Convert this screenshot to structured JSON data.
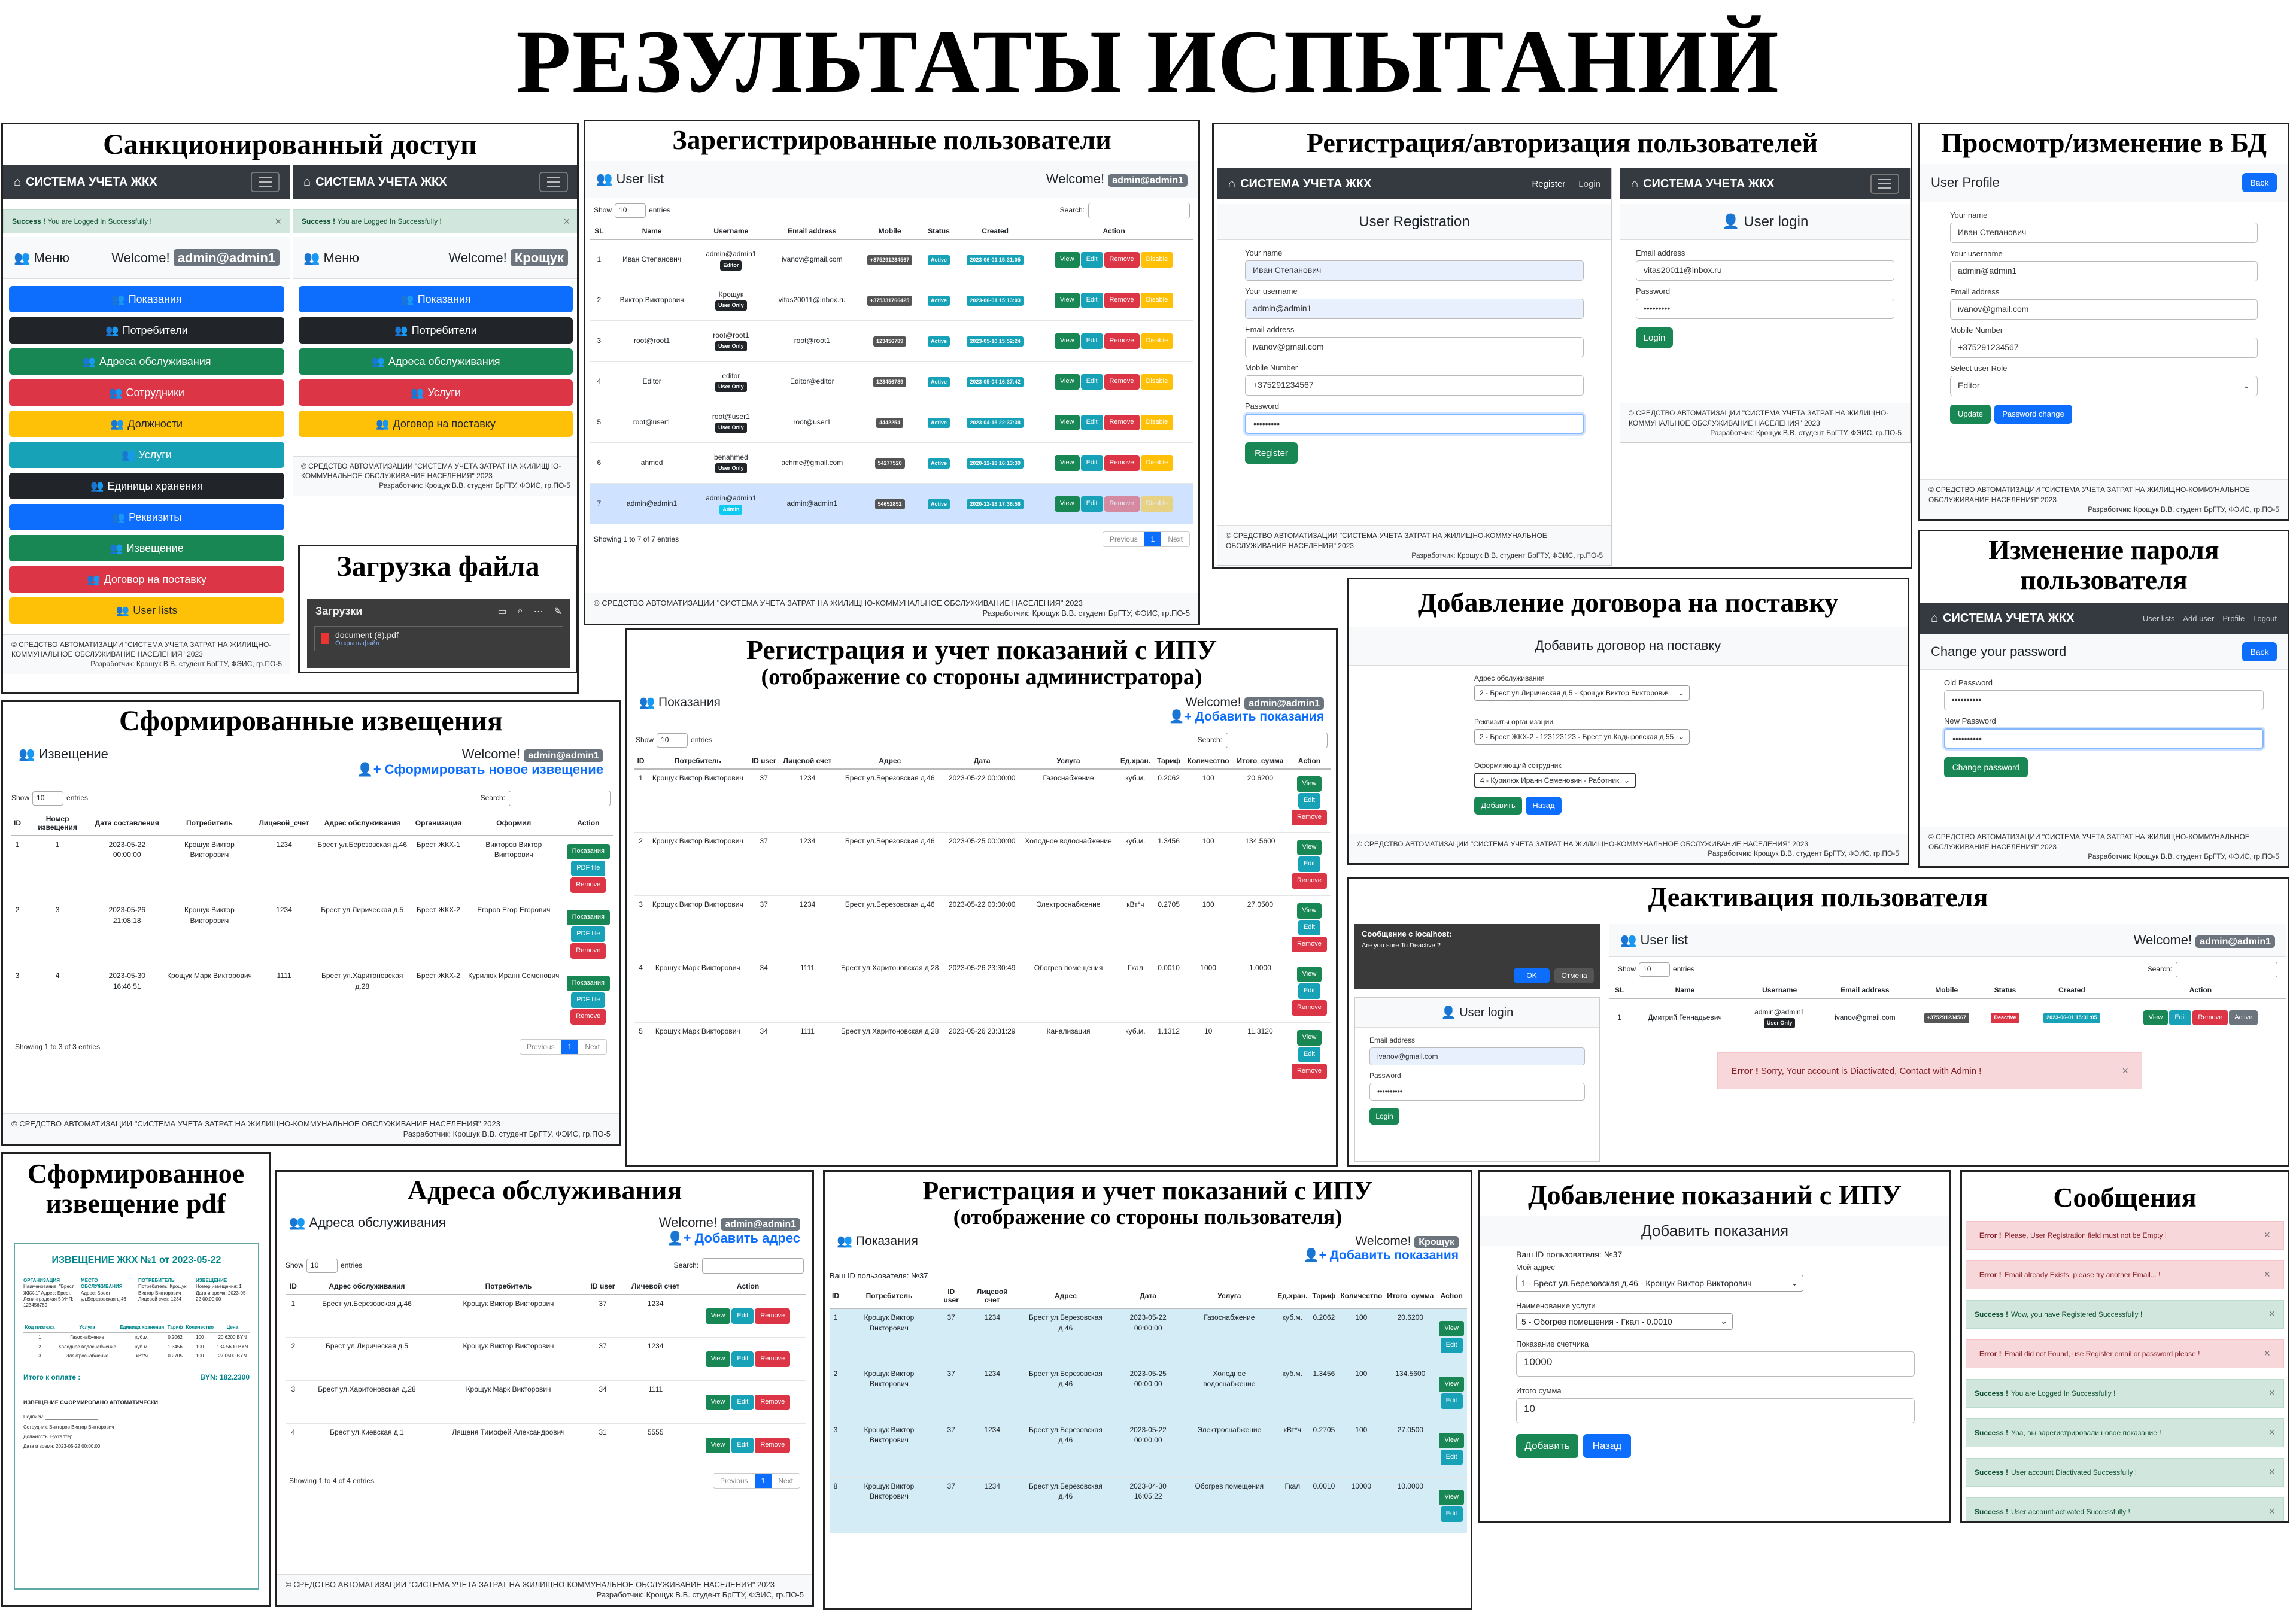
{
  "main_title": "РЕЗУЛЬТАТЫ ИСПЫТАНИЙ",
  "brand": "СИСТЕМА УЧЕТА ЖКХ",
  "footer": {
    "line1": "© СРЕДСТВО АВТОМАТИЗАЦИИ \"СИСТЕМА УЧЕТА ЗАТРАТ НА ЖИЛИЩНО-КОММУНАЛЬНОЕ ОБСЛУЖИВАНИЕ НАСЕЛЕНИЯ\" 2023",
    "author": "Разработчик: Крощук В.В. студент БрГТУ, ФЭИС, гр.ПО-5"
  },
  "welcome": "Welcome!",
  "users": {
    "admin": "admin@admin1",
    "kr": "Крощук"
  },
  "p1": {
    "title": "Санкционированный доступ",
    "alert_bold": "Success !",
    "alert": "You are Logged In Successfully !",
    "menu": "Меню",
    "items": [
      "Показания",
      "Потребители",
      "Адреса обслуживания",
      "Сотрудники",
      "Должности",
      "Услуги",
      "Единицы хранения",
      "Реквизиты",
      "Извещение",
      "Договор на поставку",
      "User lists"
    ],
    "items2": [
      "Показания",
      "Потребители",
      "Адреса обслуживания",
      "Услуги",
      "Договор на поставку"
    ]
  },
  "p2": {
    "title": "Загрузка файла",
    "header": "Загрузки",
    "file": "document (8).pdf",
    "open": "Открыть файл"
  },
  "p3": {
    "title": "Зарегистрированные пользователи",
    "list": "User list",
    "show": "Show",
    "entries": "entries",
    "n": "10",
    "search": "Search:",
    "cols": [
      "SL",
      "Name",
      "Username",
      "Email address",
      "Mobile",
      "Status",
      "Created",
      "Action"
    ],
    "rows": [
      {
        "sl": "1",
        "name": "Иван Степанович",
        "user": "admin@admin1",
        "role": "Editor",
        "email": "ivanov@gmail.com",
        "mob": "+375291234567",
        "st": "Active",
        "cr": "2023-06-01 15:31:05"
      },
      {
        "sl": "2",
        "name": "Виктор Викторович",
        "user": "Крощук",
        "role": "User Only",
        "email": "vitas20011@inbox.ru",
        "mob": "+375331766425",
        "st": "Active",
        "cr": "2023-06-01 15:13:03"
      },
      {
        "sl": "3",
        "name": "root@root1",
        "user": "root@root1",
        "role": "User Only",
        "email": "root@root1",
        "mob": "123456789",
        "st": "Active",
        "cr": "2023-05-10 15:52:24"
      },
      {
        "sl": "4",
        "name": "Editor",
        "user": "editor",
        "role": "User Only",
        "email": "Editor@editor",
        "mob": "123456789",
        "st": "Active",
        "cr": "2023-05-04 16:37:42"
      },
      {
        "sl": "5",
        "name": "root@user1",
        "user": "root@user1",
        "role": "User Only",
        "email": "root@user1",
        "mob": "4442254",
        "st": "Active",
        "cr": "2023-04-15 22:37:38"
      },
      {
        "sl": "6",
        "name": "ahmed",
        "user": "benahmed",
        "role": "User Only",
        "email": "achme@gmail.com",
        "mob": "54277520",
        "st": "Active",
        "cr": "2020-12-18 16:13:39"
      },
      {
        "sl": "7",
        "name": "admin@admin1",
        "user": "admin@admin1",
        "role": "Admin",
        "email": "admin@admin1",
        "mob": "54652852",
        "st": "Active",
        "cr": "2020-12-18 17:36:56"
      }
    ],
    "acts": [
      "View",
      "Edit",
      "Remove",
      "Disable"
    ],
    "showing": "Showing 1 to 7 of 7 entries",
    "prev": "Previous",
    "page": "1",
    "next": "Next"
  },
  "p4": {
    "title": "Регистрация/авторизация пользователей",
    "reg_links": [
      "Register",
      "Login"
    ],
    "reg": "User Registration",
    "name_l": "Your name",
    "name_v": "Иван Степанович",
    "user_l": "Your username",
    "user_v": "admin@admin1",
    "email_l": "Email address",
    "email_v": "ivanov@gmail.com",
    "mob_l": "Mobile Number",
    "mob_v": "+375291234567",
    "pass_l": "Password",
    "pass_v": "•••••••••",
    "register": "Register",
    "login": "User login",
    "lemail_l": "Email address",
    "lemail_v": "vitas20011@inbox.ru",
    "lpass_l": "Password",
    "lpass_v": "•••••••••",
    "login_btn": "Login"
  },
  "p5": {
    "title": "Просмотр/изменение в БД",
    "hdr": "User Profile",
    "back": "Back",
    "name_l": "Your name",
    "name_v": "Иван Степанович",
    "user_l": "Your username",
    "user_v": "admin@admin1",
    "email_l": "Email address",
    "email_v": "ivanov@gmail.com",
    "mob_l": "Mobile Number",
    "mob_v": "+375291234567",
    "role_l": "Select user Role",
    "role_v": "Editor",
    "update": "Update",
    "pchange": "Password change"
  },
  "p6": {
    "title": "Изменение пароля пользователя",
    "links": [
      "User lists",
      "Add user",
      "Profile",
      "Logout"
    ],
    "hdr": "Change your password",
    "back": "Back",
    "old_l": "Old Password",
    "old_v": "••••••••••",
    "new_l": "New Password",
    "new_v": "••••••••••",
    "btn": "Change password"
  },
  "p7": {
    "title": "Добавление договора на поставку",
    "hdr": "Добавить договор на поставку",
    "a_l": "Адрес обслуживания",
    "a_v": "2 - Брест ул.Лирическая д.5 - Крощук Виктор Викторович",
    "r_l": "Реквизиты организации",
    "r_v": "2 - Брест ЖКХ-2 - 123123123 - Брест ул.Кадыровская д.55",
    "o_l": "Оформляющий сотрудник",
    "o_v": "4 - Курилюк Иранн Семеновин - Работник",
    "add": "Добавить",
    "back": "Назад"
  },
  "p8": {
    "title": "Сформированные извещения",
    "hdr": "Извещение",
    "add": "Сформировать новое извещение",
    "cols": [
      "ID",
      "Номер извещения",
      "Дата составления",
      "Потребитель",
      "Лицевой_счет",
      "Адрес обслуживания",
      "Организация",
      "Оформил",
      "Action"
    ],
    "rows": [
      {
        "id": "1",
        "num": "1",
        "date": "2023-05-22 00:00:00",
        "cons": "Крощук Виктор Викторович",
        "acc": "1234",
        "addr": "Брест ул.Березовская д.46",
        "org": "Брест ЖКХ-1",
        "by": "Викторов Виктор Викторович"
      },
      {
        "id": "2",
        "num": "3",
        "date": "2023-05-26 21:08:18",
        "cons": "Крощук Виктор Викторович",
        "acc": "1234",
        "addr": "Брест ул.Лирическая д.5",
        "org": "Брест ЖКХ-2",
        "by": "Егоров Егор Егорович"
      },
      {
        "id": "3",
        "num": "4",
        "date": "2023-05-30 16:46:51",
        "cons": "Крощук Марк Викторович",
        "acc": "1111",
        "addr": "Брест ул.Харитоновская д.28",
        "org": "Брест ЖКХ-2",
        "by": "Курилюк Иранн Семенович"
      }
    ],
    "acts": [
      "Показания",
      "PDF file",
      "Remove"
    ],
    "showing": "Showing 1 to 3 of 3 entries"
  },
  "p9": {
    "title": "Регистрация и учет показаний с ИПУ",
    "sub": "(отображение со стороны администратора)",
    "hdr": "Показания",
    "add": "Добавить показания",
    "cols": [
      "ID",
      "Потребитель",
      "ID user",
      "Лицевой счет",
      "Адрес",
      "Дата",
      "Услуга",
      "Ед.хран.",
      "Тариф",
      "Количество",
      "Итого_сумма",
      "Action"
    ],
    "rows": [
      {
        "id": "1",
        "cons": "Крощук Виктор Викторович",
        "uid": "37",
        "acc": "1234",
        "addr": "Брест ул.Березовская д.46",
        "date": "2023-05-22 00:00:00",
        "serv": "Газоснабжение",
        "unit": "куб.м.",
        "tar": "0.2062",
        "qty": "100",
        "sum": "20.6200"
      },
      {
        "id": "2",
        "cons": "Крощук Виктор Викторович",
        "uid": "37",
        "acc": "1234",
        "addr": "Брест ул.Березовская д.46",
        "date": "2023-05-25 00:00:00",
        "serv": "Холодное водоснабжение",
        "unit": "куб.м.",
        "tar": "1.3456",
        "qty": "100",
        "sum": "134.5600"
      },
      {
        "id": "3",
        "cons": "Крощук Виктор Викторович",
        "uid": "37",
        "acc": "1234",
        "addr": "Брест ул.Березовская д.46",
        "date": "2023-05-22 00:00:00",
        "serv": "Электроснабжение",
        "unit": "кВт*ч",
        "tar": "0.2705",
        "qty": "100",
        "sum": "27.0500"
      },
      {
        "id": "4",
        "cons": "Крощук Марк Викторович",
        "uid": "34",
        "acc": "1111",
        "addr": "Брест ул.Харитоновская д.28",
        "date": "2023-05-26 23:30:49",
        "serv": "Обогрев помещения",
        "unit": "Гкал",
        "tar": "0.0010",
        "qty": "1000",
        "sum": "1.0000"
      },
      {
        "id": "5",
        "cons": "Крощук Марк Викторович",
        "uid": "34",
        "acc": "1111",
        "addr": "Брест ул.Харитоновская д.28",
        "date": "2023-05-26 23:31:29",
        "serv": "Канализация",
        "unit": "куб.м.",
        "tar": "1.1312",
        "qty": "10",
        "sum": "11.3120"
      }
    ],
    "acts": [
      "View",
      "Edit",
      "Remove"
    ]
  },
  "p10": {
    "title": "Деактивация пользователя",
    "dlg_title": "Сообщение с localhost:",
    "dlg_text": "Are you sure To Deactive ?",
    "ok": "OK",
    "cancel": "Отмена",
    "login": "User login",
    "email_l": "Email address",
    "email_v": "ivanov@gmail.com",
    "pass_l": "Password",
    "pass_v": "••••••••••",
    "login_btn": "Login",
    "list": "User list",
    "row": {
      "sl": "1",
      "name": "Дмитрий Геннадьевич",
      "user": "admin@admin1",
      "role": "User Only",
      "email": "ivanov@gmail.com",
      "mob": "+375291234567",
      "st": "Deactive",
      "cr": "2023-06-01 15:31:05"
    },
    "acts": [
      "View",
      "Edit",
      "Remove",
      "Active"
    ],
    "err_bold": "Error !",
    "err": "Sorry, Your account is Diactivated, Contact with Admin !"
  },
  "p11": {
    "title": "Сформированное извещение pdf",
    "h": "ИЗВЕЩЕНИЕ ЖКХ №1 от 2023-05-22",
    "org_h": "ОРГАНИЗАЦИЯ",
    "place_h": "МЕСТО ОБСЛУЖИВАНИЯ",
    "cons_h": "ПОТРЕБИТЕЛЬ",
    "izv_h": "ИЗВЕЩЕНИЕ",
    "org": "Наименование: \"Брест ЖКХ-1\" Адрес: Брест, Ленинградская 5 УНП: 123456789",
    "place": "Адрес: Брест ул.Березовская д.46",
    "cons": "Потребитель: Крощук Виктор Викторович Лицевой счет: 1234",
    "izv": "Номер извещения: 1 Дата и время: 2023-05-22 00:00:00",
    "cols": [
      "Код платежа",
      "Услуга",
      "Единица хранения",
      "Тариф",
      "Количество",
      "Цена"
    ],
    "rows": [
      [
        "1",
        "Газоснабжение",
        "куб.м.",
        "0.2062",
        "100",
        "20.6200 BYN"
      ],
      [
        "2",
        "Холодное водоснабжение",
        "куб.м.",
        "1.3456",
        "100",
        "134.5600 BYN"
      ],
      [
        "3",
        "Электроснабжение",
        "кВт*ч",
        "0.2705",
        "100",
        "27.0500 BYN"
      ]
    ],
    "total_l": "Итого к оплате :",
    "total": "BYN: 182.2300",
    "auto": "ИЗВЕЩЕНИЕ СФОРМИРОВАНО АВТОМАТИЧЕСКИ",
    "sign": "Подпись: ____________________",
    "emp": "Сотрудник: Викторов Виктор Викторович",
    "pos": "Должность: Бухгалтер",
    "dt": "Дата и время: 2023-05-22 00:00:00"
  },
  "p12": {
    "title": "Адреса обслуживания",
    "hdr": "Адреса обслуживания",
    "add": "Добавить адрес",
    "cols": [
      "ID",
      "Адрес обслуживания",
      "Потребитель",
      "ID user",
      "Личевой счет",
      "Action"
    ],
    "rows": [
      [
        "1",
        "Брест ул.Березовская д.46",
        "Крощук Виктор Викторович",
        "37",
        "1234"
      ],
      [
        "2",
        "Брест ул.Лирическая д.5",
        "Крощук Виктор Викторович",
        "37",
        "1234"
      ],
      [
        "3",
        "Брест ул.Харитоновская д.28",
        "Крощук Марк Викторович",
        "34",
        "1111"
      ],
      [
        "4",
        "Брест ул.Киевская д.1",
        "Лященя Тимофей Александрович",
        "31",
        "5555"
      ]
    ],
    "showing": "Showing 1 to 4 of 4 entries"
  },
  "p13": {
    "title": "Регистрация и учет показаний с ИПУ",
    "sub": "(отображение со стороны пользователя)",
    "hdr": "Показания",
    "uid": "Ваш ID пользователя: №37",
    "rows": [
      {
        "id": "1",
        "cons": "Крощук Виктор Викторович",
        "uid": "37",
        "acc": "1234",
        "addr": "Брест ул.Березовская д.46",
        "date": "2023-05-22 00:00:00",
        "serv": "Газоснабжение",
        "unit": "куб.м.",
        "tar": "0.2062",
        "qty": "100",
        "sum": "20.6200"
      },
      {
        "id": "2",
        "cons": "Крощук Виктор Викторович",
        "uid": "37",
        "acc": "1234",
        "addr": "Брест ул.Березовская д.46",
        "date": "2023-05-25 00:00:00",
        "serv": "Холодное водоснабжение",
        "unit": "куб.м.",
        "tar": "1.3456",
        "qty": "100",
        "sum": "134.5600"
      },
      {
        "id": "3",
        "cons": "Крощук Виктор Викторович",
        "uid": "37",
        "acc": "1234",
        "addr": "Брест ул.Березовская д.46",
        "date": "2023-05-22 00:00:00",
        "serv": "Электроснабжение",
        "unit": "кВт*ч",
        "tar": "0.2705",
        "qty": "100",
        "sum": "27.0500"
      },
      {
        "id": "8",
        "cons": "Крощук Виктор Викторович",
        "uid": "37",
        "acc": "1234",
        "addr": "Брест ул.Березовская д.46",
        "date": "2023-04-30 16:05:22",
        "serv": "Обогрев помещения",
        "unit": "Гкал",
        "tar": "0.0010",
        "qty": "10000",
        "sum": "10.0000"
      }
    ]
  },
  "p14": {
    "title": "Добавление показаний с ИПУ",
    "hdr": "Добавить показания",
    "uid": "Ваш ID пользователя: №37",
    "addr_l": "Мой адрес",
    "addr_v": "1 - Брест ул.Березовская д.46 - Крощук Виктор Викторович",
    "serv_l": "Наименование услуги",
    "serv_v": "5 - Обогрев помещения - Гкал - 0.0010",
    "cnt_l": "Показание счетчика",
    "cnt_v": "10000",
    "sum_l": "Итого сумма",
    "sum_v": "10",
    "add": "Добавить",
    "back": "Назад"
  },
  "p15": {
    "title": "Сообщения",
    "msgs": [
      {
        "t": "err",
        "b": "Error !",
        "m": "Please, User Registration field must not be Empty !"
      },
      {
        "t": "err",
        "b": "Error !",
        "m": "Email already Exists, please try another Email... !"
      },
      {
        "t": "ok",
        "b": "Success !",
        "m": "Wow, you have Registered Successfully !"
      },
      {
        "t": "err",
        "b": "Error !",
        "m": "Email did not Found, use Register email or password please !"
      },
      {
        "t": "ok",
        "b": "Success !",
        "m": "You are Logged In Successfully !"
      },
      {
        "t": "ok",
        "b": "Success !",
        "m": "Ура, вы зарегистрировали новое показание !"
      },
      {
        "t": "ok",
        "b": "Success !",
        "m": "User account Diactivated Successfully !"
      },
      {
        "t": "ok",
        "b": "Success !",
        "m": "User account activated Successfully !"
      }
    ]
  }
}
